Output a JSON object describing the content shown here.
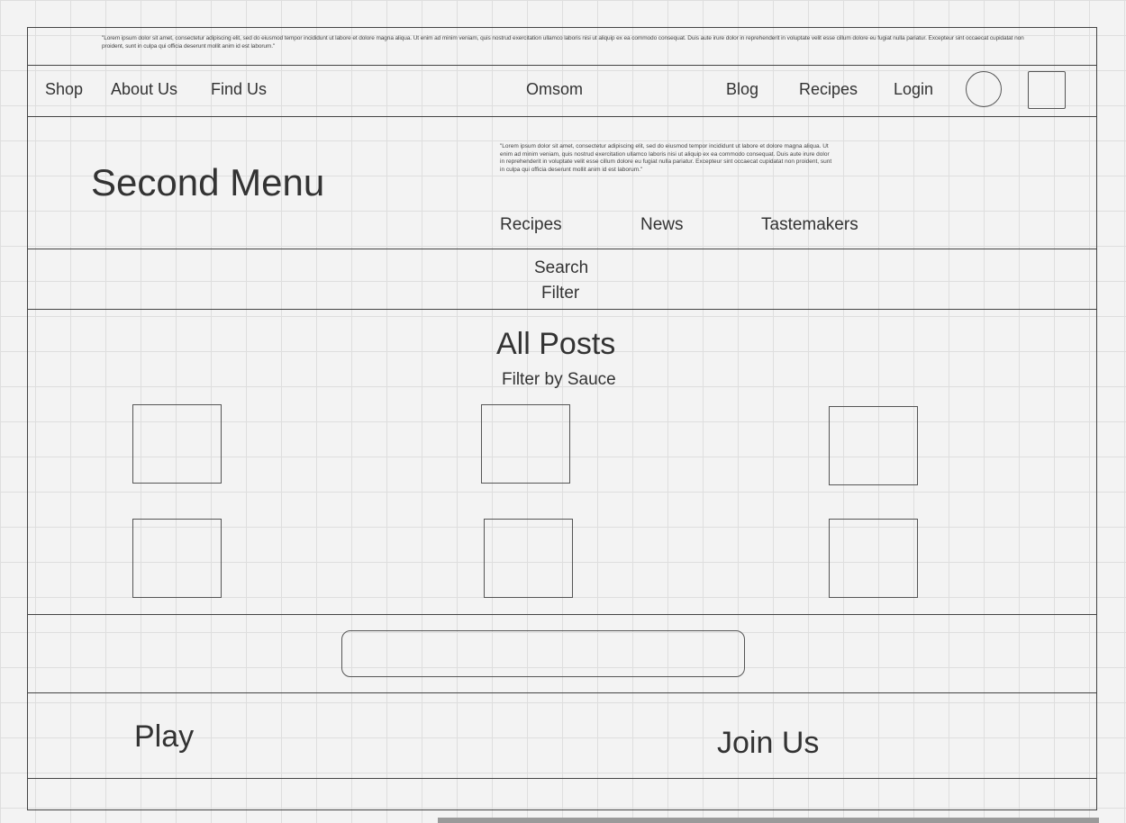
{
  "announcement": {
    "text": "\"Lorem ipsum dolor sit amet, consectetur adipiscing elit, sed do eiusmod tempor incididunt ut labore et dolore magna aliqua. Ut enim ad minim veniam, quis nostrud exercitation ullamco laboris nisi ut aliquip ex ea commodo consequat. Duis aute irure dolor in reprehenderit in voluptate velit esse cillum dolore eu fugiat nulla pariatur. Excepteur sint occaecat cupidatat non proident, sunt in culpa qui officia deserunt mollit anim id est laborum.\""
  },
  "header": {
    "left_links": [
      "Shop",
      "About Us",
      "Find Us"
    ],
    "brand": "Omsom",
    "right_links": [
      "Blog",
      "Recipes",
      "Login"
    ],
    "icons": [
      "circle-icon",
      "square-icon"
    ]
  },
  "second_menu": {
    "title": "Second Menu",
    "description": "\"Lorem ipsum dolor sit amet, consectetur adipiscing elit, sed do eiusmod tempor incididunt ut labore et dolore magna aliqua. Ut enim ad minim veniam, quis nostrud exercitation ullamco laboris nisi ut aliquip ex ea commodo consequat. Duis aute irure dolor in reprehenderit in voluptate velit esse cillum dolore eu fugiat nulla pariatur. Excepteur sint occaecat cupidatat non proident, sunt in culpa qui officia deserunt mollit anim id est laborum.\"",
    "links": [
      "Recipes",
      "News",
      "Tastemakers"
    ]
  },
  "search_filter": {
    "search_label": "Search",
    "filter_label": "Filter"
  },
  "posts": {
    "title": "All Posts",
    "filter_label": "Filter by Sauce"
  },
  "footer": {
    "play_label": "Play",
    "join_label": "Join Us"
  }
}
